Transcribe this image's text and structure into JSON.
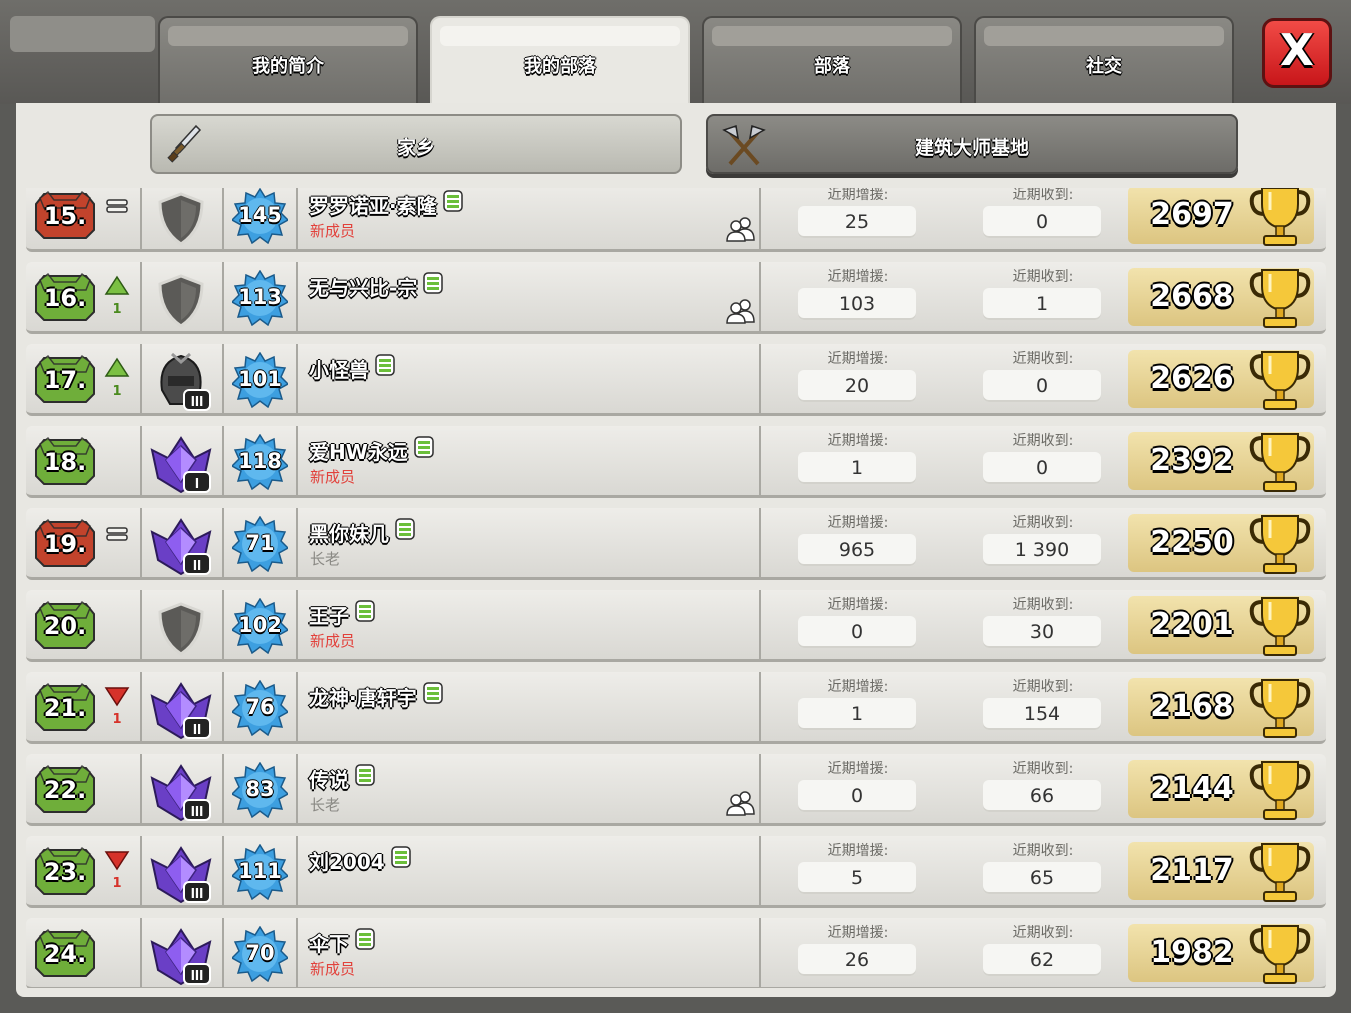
{
  "tabs": [
    {
      "label": "我的简介",
      "active": false
    },
    {
      "label": "我的部落",
      "active": true
    },
    {
      "label": "部落",
      "active": false
    },
    {
      "label": "社交",
      "active": false
    }
  ],
  "close_label": "X",
  "subtabs": {
    "home": {
      "label": "家乡",
      "icon": "sword-icon",
      "active": true
    },
    "builder": {
      "label": "建筑大师基地",
      "icon": "crossed-axes-icon",
      "active": false
    }
  },
  "stat_captions": {
    "donated": "近期增援:",
    "received": "近期收到:"
  },
  "colors": {
    "rank_red": "#c2432c",
    "rank_green": "#6fae3a",
    "trend_up": "#7bc043",
    "trend_down": "#d6322a",
    "role_new": "#e2413b",
    "role_elder": "#8a8984",
    "league_crystal": "#7a3fd0",
    "xp_badge": "#3aa0e0"
  },
  "members": [
    {
      "rank": "15.",
      "rank_color": "red",
      "trend": "same",
      "trend_value": "",
      "league": "unranked-shield",
      "league_tier": "",
      "level": "145",
      "name": "罗罗诺亚·索隆",
      "role": "新成员",
      "role_type": "new",
      "friend": true,
      "donated": "25",
      "received": "0",
      "trophies": "2697"
    },
    {
      "rank": "16.",
      "rank_color": "green",
      "trend": "up",
      "trend_value": "1",
      "league": "unranked-shield",
      "league_tier": "",
      "level": "113",
      "name": "无与兴比-宗",
      "role": "",
      "role_type": "",
      "friend": true,
      "donated": "103",
      "received": "1",
      "trophies": "2668"
    },
    {
      "rank": "17.",
      "rank_color": "green",
      "trend": "up",
      "trend_value": "1",
      "league": "iron-helmet",
      "league_tier": "III",
      "level": "101",
      "name": "小怪兽",
      "role": "",
      "role_type": "",
      "friend": false,
      "donated": "20",
      "received": "0",
      "trophies": "2626"
    },
    {
      "rank": "18.",
      "rank_color": "green",
      "trend": "none",
      "trend_value": "",
      "league": "crystal",
      "league_tier": "I",
      "level": "118",
      "name": "爱HW永远",
      "role": "新成员",
      "role_type": "new",
      "friend": false,
      "donated": "1",
      "received": "0",
      "trophies": "2392"
    },
    {
      "rank": "19.",
      "rank_color": "red",
      "trend": "same",
      "trend_value": "",
      "league": "crystal",
      "league_tier": "II",
      "level": "71",
      "name": "黑你妹几",
      "role": "长老",
      "role_type": "elder",
      "friend": false,
      "donated": "965",
      "received": "1 390",
      "trophies": "2250"
    },
    {
      "rank": "20.",
      "rank_color": "green",
      "trend": "none",
      "trend_value": "",
      "league": "unranked-shield",
      "league_tier": "",
      "level": "102",
      "name": "王子",
      "role": "新成员",
      "role_type": "new",
      "friend": false,
      "donated": "0",
      "received": "30",
      "trophies": "2201"
    },
    {
      "rank": "21.",
      "rank_color": "green",
      "trend": "down",
      "trend_value": "1",
      "league": "crystal",
      "league_tier": "II",
      "level": "76",
      "name": "龙神·唐轩宇",
      "role": "",
      "role_type": "",
      "friend": false,
      "donated": "1",
      "received": "154",
      "trophies": "2168"
    },
    {
      "rank": "22.",
      "rank_color": "green",
      "trend": "none",
      "trend_value": "",
      "league": "crystal",
      "league_tier": "III",
      "level": "83",
      "name": "传说",
      "role": "长老",
      "role_type": "elder",
      "friend": true,
      "donated": "0",
      "received": "66",
      "trophies": "2144"
    },
    {
      "rank": "23.",
      "rank_color": "green",
      "trend": "down",
      "trend_value": "1",
      "league": "crystal",
      "league_tier": "III",
      "level": "111",
      "name": "刘2004",
      "role": "",
      "role_type": "",
      "friend": false,
      "donated": "5",
      "received": "65",
      "trophies": "2117"
    },
    {
      "rank": "24.",
      "rank_color": "green",
      "trend": "none",
      "trend_value": "",
      "league": "crystal",
      "league_tier": "III",
      "level": "70",
      "name": "伞下",
      "role": "新成员",
      "role_type": "new",
      "friend": false,
      "donated": "26",
      "received": "62",
      "trophies": "1982"
    }
  ]
}
